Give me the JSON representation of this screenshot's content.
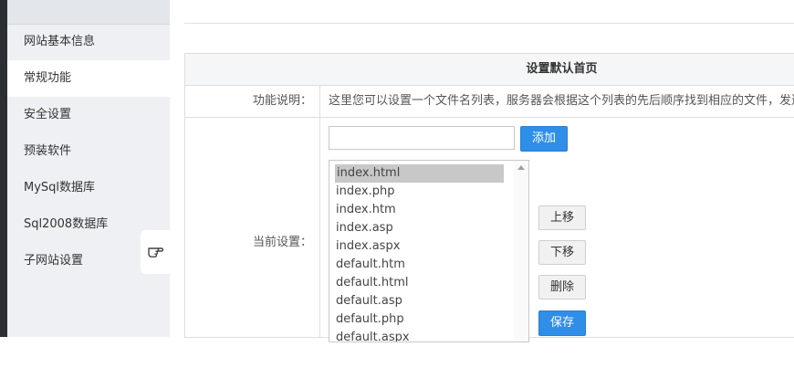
{
  "sidebar": {
    "items": [
      {
        "label": "网站基本信息",
        "active": false
      },
      {
        "label": "常规功能",
        "active": true
      },
      {
        "label": "安全设置",
        "active": false
      },
      {
        "label": "预装软件",
        "active": false
      },
      {
        "label": "MySql数据库",
        "active": false
      },
      {
        "label": "Sql2008数据库",
        "active": false
      },
      {
        "label": "子网站设置",
        "active": false
      }
    ],
    "handle_icon": "hand-pointer-icon"
  },
  "panel": {
    "title": "设置默认首页",
    "desc_label": "功能说明：",
    "desc_text": "这里您可以设置一个文件名列表，服务器会根据这个列表的先后顺序找到相应的文件，发送",
    "current_label": "当前设置：",
    "input_value": "",
    "add_label": "添加",
    "files": [
      "index.html",
      "index.php",
      "index.htm",
      "index.asp",
      "index.aspx",
      "default.htm",
      "default.html",
      "default.asp",
      "default.php",
      "default.aspx"
    ],
    "selected_file": "index.html",
    "move_up_label": "上移",
    "move_down_label": "下移",
    "delete_label": "删除",
    "save_label": "保存"
  },
  "colors": {
    "accent": "#2e8ee8",
    "sidebar_bg": "#eef0f3"
  }
}
